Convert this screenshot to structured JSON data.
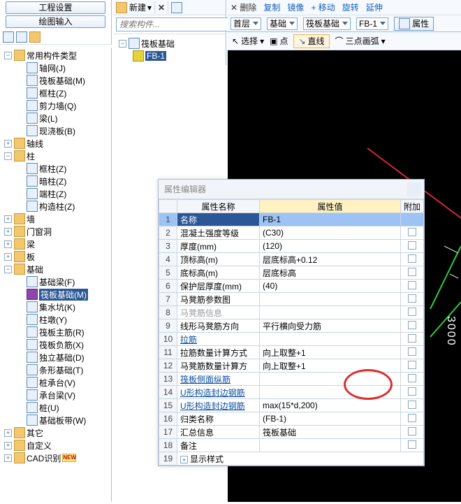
{
  "topLeft": {
    "btn1": "工程设置",
    "btn2": "绘图输入"
  },
  "midHead": {
    "newLabel": "新建",
    "searchPlaceholder": "搜索构件..."
  },
  "midTree": {
    "parent": "筏板基础",
    "child": "FB-1"
  },
  "rtTopTools": {
    "delete": "删除",
    "copy": "复制",
    "mirror": "镜像",
    "move": "移动",
    "rotate": "旋转",
    "extend": "延伸"
  },
  "rtCombos": {
    "floor": "首层",
    "foundation": "基础",
    "raft": "筏板基础",
    "fb": "FB-1",
    "attr": "属性"
  },
  "rtDrawTools": {
    "select": "选择",
    "point": "点",
    "line": "直线",
    "arc": "三点画弧"
  },
  "canvas": {
    "dim": "3000"
  },
  "propDlg": {
    "title": "属性编辑器",
    "headers": {
      "name": "属性名称",
      "value": "属性值",
      "attach": "附加"
    },
    "rows": [
      {
        "n": "1",
        "name": "名称",
        "val": "FB-1",
        "sel": true
      },
      {
        "n": "2",
        "name": "混凝土强度等级",
        "val": "(C30)",
        "chk": true
      },
      {
        "n": "3",
        "name": "厚度(mm)",
        "val": "(120)",
        "chk": true
      },
      {
        "n": "4",
        "name": "顶标高(m)",
        "val": "层底标高+0.12",
        "chk": true
      },
      {
        "n": "5",
        "name": "底标高(m)",
        "val": "层底标高",
        "chk": true
      },
      {
        "n": "6",
        "name": "保护层厚度(mm)",
        "val": "(40)",
        "chk": true
      },
      {
        "n": "7",
        "name": "马凳筋参数图",
        "val": "",
        "chk": true
      },
      {
        "n": "8",
        "name": "马凳筋信息",
        "val": "",
        "grey": true,
        "chk": true
      },
      {
        "n": "9",
        "name": "线形马凳筋方向",
        "val": "平行横向受力筋",
        "chk": true
      },
      {
        "n": "10",
        "name": "拉筋",
        "val": "",
        "link": true,
        "chk": true
      },
      {
        "n": "11",
        "name": "拉筋数量计算方式",
        "val": "向上取整+1",
        "chk": true
      },
      {
        "n": "12",
        "name": "马凳筋数量计算方",
        "val": "向上取整+1",
        "chk": true
      },
      {
        "n": "13",
        "name": "筏板侧面纵筋",
        "val": "",
        "link": true,
        "chk": true
      },
      {
        "n": "14",
        "name": "U形构造封边钢筋",
        "val": "",
        "link": true,
        "chk": true
      },
      {
        "n": "15",
        "name": "U形构造封边钢筋",
        "val": "max(15*d,200)",
        "link": true,
        "chk": true
      },
      {
        "n": "16",
        "name": "归类名称",
        "val": "(FB-1)",
        "chk": true
      },
      {
        "n": "17",
        "name": "汇总信息",
        "val": "筏板基础",
        "chk": true
      },
      {
        "n": "18",
        "name": "备注",
        "val": "",
        "chk": true
      }
    ],
    "lastRow": {
      "n": "19",
      "label": "显示样式"
    }
  },
  "tree": [
    {
      "d": 0,
      "exp": "-",
      "ico": "folder",
      "lbl": "常用构件类型",
      "intr": true
    },
    {
      "d": 1,
      "exp": "none",
      "ico": "item",
      "lbl": "轴网(J)",
      "intr": true
    },
    {
      "d": 1,
      "exp": "none",
      "ico": "item",
      "lbl": "筏板基础(M)",
      "intr": true
    },
    {
      "d": 1,
      "exp": "none",
      "ico": "item",
      "lbl": "框柱(Z)",
      "intr": true
    },
    {
      "d": 1,
      "exp": "none",
      "ico": "item",
      "lbl": "剪力墙(Q)",
      "intr": true
    },
    {
      "d": 1,
      "exp": "none",
      "ico": "item",
      "lbl": "梁(L)",
      "intr": true
    },
    {
      "d": 1,
      "exp": "none",
      "ico": "item",
      "lbl": "现浇板(B)",
      "intr": true
    },
    {
      "d": 0,
      "exp": "+",
      "ico": "folder",
      "lbl": "轴线",
      "intr": true
    },
    {
      "d": 0,
      "exp": "-",
      "ico": "folder",
      "lbl": "柱",
      "intr": true
    },
    {
      "d": 1,
      "exp": "none",
      "ico": "item",
      "lbl": "框柱(Z)",
      "intr": true
    },
    {
      "d": 1,
      "exp": "none",
      "ico": "item",
      "lbl": "暗柱(Z)",
      "intr": true
    },
    {
      "d": 1,
      "exp": "none",
      "ico": "item",
      "lbl": "端柱(Z)",
      "intr": true
    },
    {
      "d": 1,
      "exp": "none",
      "ico": "item",
      "lbl": "构造柱(Z)",
      "intr": true
    },
    {
      "d": 0,
      "exp": "+",
      "ico": "folder",
      "lbl": "墙",
      "intr": true
    },
    {
      "d": 0,
      "exp": "+",
      "ico": "folder",
      "lbl": "门窗洞",
      "intr": true
    },
    {
      "d": 0,
      "exp": "+",
      "ico": "folder",
      "lbl": "梁",
      "intr": true
    },
    {
      "d": 0,
      "exp": "+",
      "ico": "folder",
      "lbl": "板",
      "intr": true
    },
    {
      "d": 0,
      "exp": "-",
      "ico": "folder",
      "lbl": "基础",
      "intr": true
    },
    {
      "d": 1,
      "exp": "none",
      "ico": "item",
      "lbl": "基础梁(F)",
      "intr": true
    },
    {
      "d": 1,
      "exp": "none",
      "ico": "sel",
      "lbl": "筏板基础(M)",
      "sel": true,
      "intr": true
    },
    {
      "d": 1,
      "exp": "none",
      "ico": "item",
      "lbl": "集水坑(K)",
      "intr": true
    },
    {
      "d": 1,
      "exp": "none",
      "ico": "item",
      "lbl": "柱墩(Y)",
      "intr": true
    },
    {
      "d": 1,
      "exp": "none",
      "ico": "item",
      "lbl": "筏板主筋(R)",
      "intr": true
    },
    {
      "d": 1,
      "exp": "none",
      "ico": "item",
      "lbl": "筏板负筋(X)",
      "intr": true
    },
    {
      "d": 1,
      "exp": "none",
      "ico": "item",
      "lbl": "独立基础(D)",
      "intr": true
    },
    {
      "d": 1,
      "exp": "none",
      "ico": "item",
      "lbl": "条形基础(T)",
      "intr": true
    },
    {
      "d": 1,
      "exp": "none",
      "ico": "item",
      "lbl": "桩承台(V)",
      "intr": true
    },
    {
      "d": 1,
      "exp": "none",
      "ico": "item",
      "lbl": "承台梁(V)",
      "intr": true
    },
    {
      "d": 1,
      "exp": "none",
      "ico": "item",
      "lbl": "桩(U)",
      "intr": true
    },
    {
      "d": 1,
      "exp": "none",
      "ico": "item",
      "lbl": "基础板带(W)",
      "intr": true
    },
    {
      "d": 0,
      "exp": "+",
      "ico": "folder",
      "lbl": "其它",
      "intr": true
    },
    {
      "d": 0,
      "exp": "+",
      "ico": "folder",
      "lbl": "自定义",
      "intr": true
    },
    {
      "d": 0,
      "exp": "+",
      "ico": "folder",
      "lbl": "CAD识别",
      "new": true,
      "intr": true
    }
  ]
}
